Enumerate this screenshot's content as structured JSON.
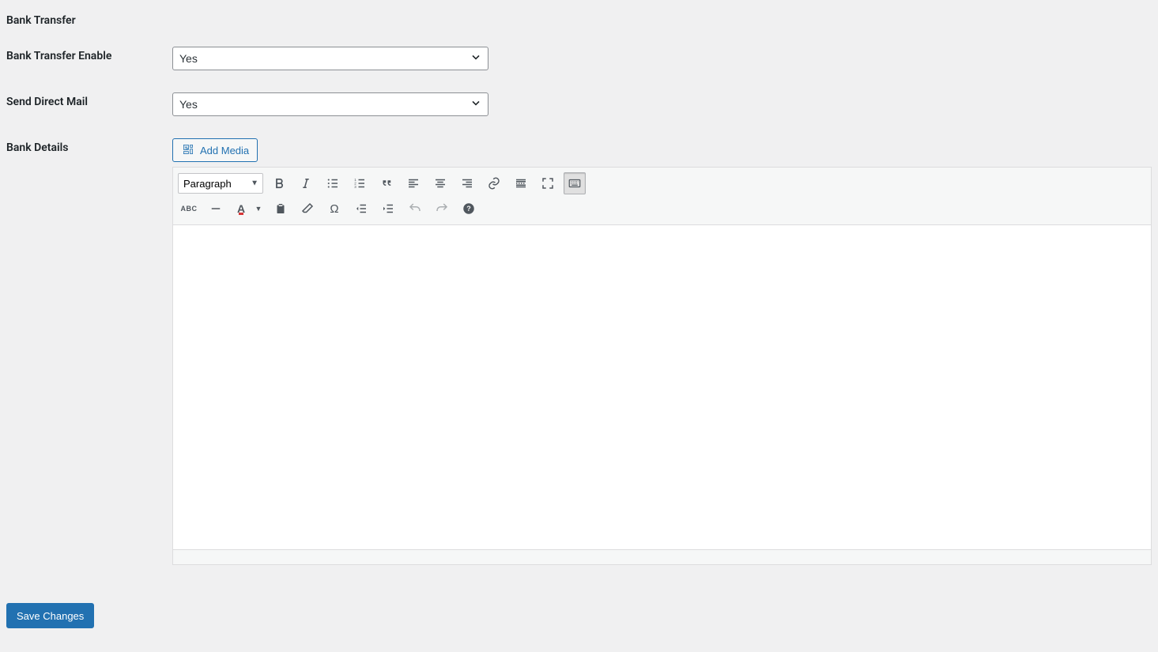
{
  "section": {
    "title": "Bank Transfer"
  },
  "fields": {
    "enable": {
      "label": "Bank Transfer Enable",
      "value": "Yes"
    },
    "sendmail": {
      "label": "Send Direct Mail",
      "value": "Yes"
    },
    "bankdetails": {
      "label": "Bank Details"
    }
  },
  "addmedia": {
    "label": "Add Media"
  },
  "editor": {
    "format_value": "Paragraph"
  },
  "buttons": {
    "save": "Save Changes"
  }
}
